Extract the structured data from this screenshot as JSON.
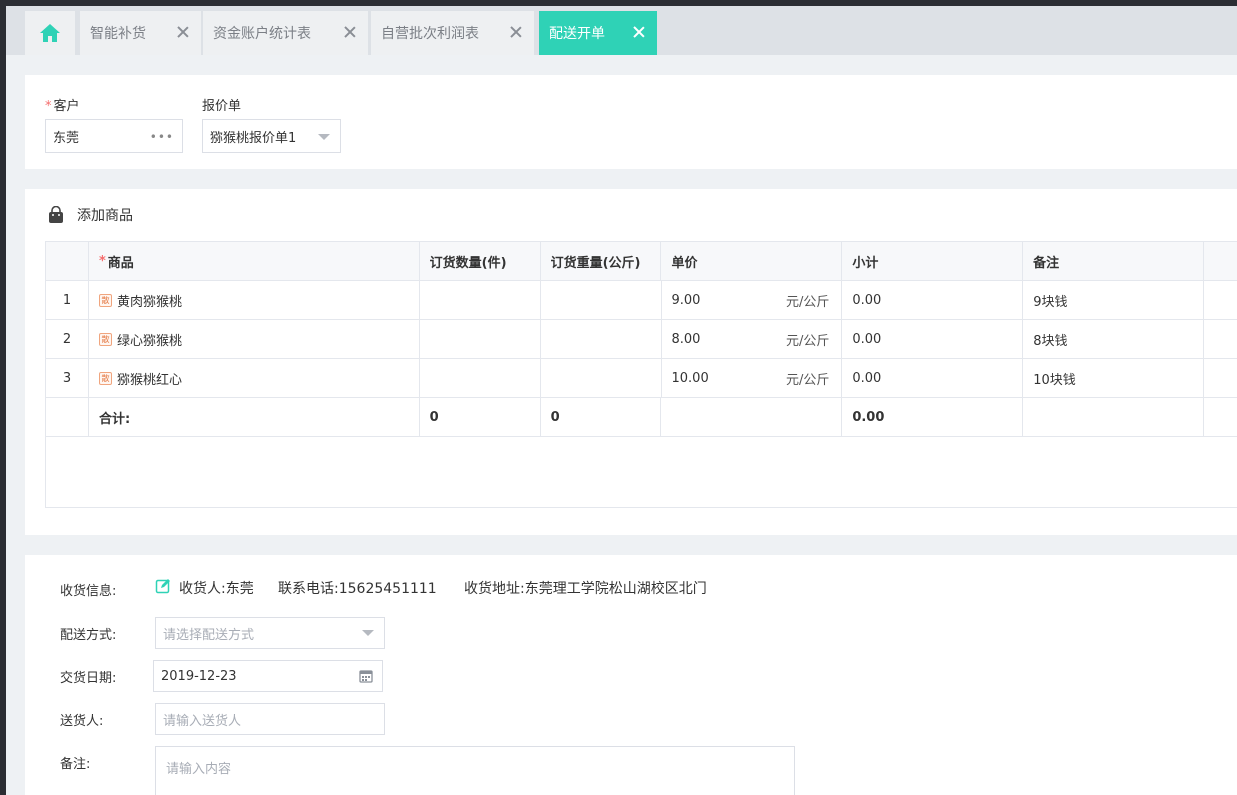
{
  "tabs": [
    {
      "label": "智能补货"
    },
    {
      "label": "资金账户统计表"
    },
    {
      "label": "自营批次利润表"
    },
    {
      "label": "配送开单"
    }
  ],
  "form": {
    "customer_label": "客户",
    "customer_value": "东莞",
    "quote_label": "报价单",
    "quote_value": "猕猴桃报价单1"
  },
  "goods": {
    "title": "添加商品",
    "headers": [
      "商品",
      "订货数量(件)",
      "订货重量(公斤)",
      "单价",
      "小计",
      "备注"
    ],
    "badge": "散",
    "unit": "元/公斤",
    "rows": [
      {
        "index": "1",
        "name": "黄肉猕猴桃",
        "price": "9.00",
        "subtotal": "0.00",
        "note": "9块钱"
      },
      {
        "index": "2",
        "name": "绿心猕猴桃",
        "price": "8.00",
        "subtotal": "0.00",
        "note": "8块钱"
      },
      {
        "index": "3",
        "name": "猕猴桃红心",
        "price": "10.00",
        "subtotal": "0.00",
        "note": "10块钱"
      }
    ],
    "total": {
      "label": "合计:",
      "qty": "0",
      "weight": "0",
      "subtotal": "0.00"
    }
  },
  "delivery": {
    "receive_label": "收货信息:",
    "receiver": "收货人:东莞",
    "phone": "联系电话:15625451111",
    "address": "收货地址:东莞理工学院松山湖校区北门",
    "method_label": "配送方式:",
    "method_placeholder": "请选择配送方式",
    "date_label": "交货日期:",
    "date_value": "2019-12-23",
    "courier_label": "送货人:",
    "courier_placeholder": "请输入送货人",
    "note_label": "备注:",
    "note_placeholder": "请输入内容"
  },
  "colors": {
    "accent": "#2fd2b6",
    "required": "#f56c6c"
  }
}
